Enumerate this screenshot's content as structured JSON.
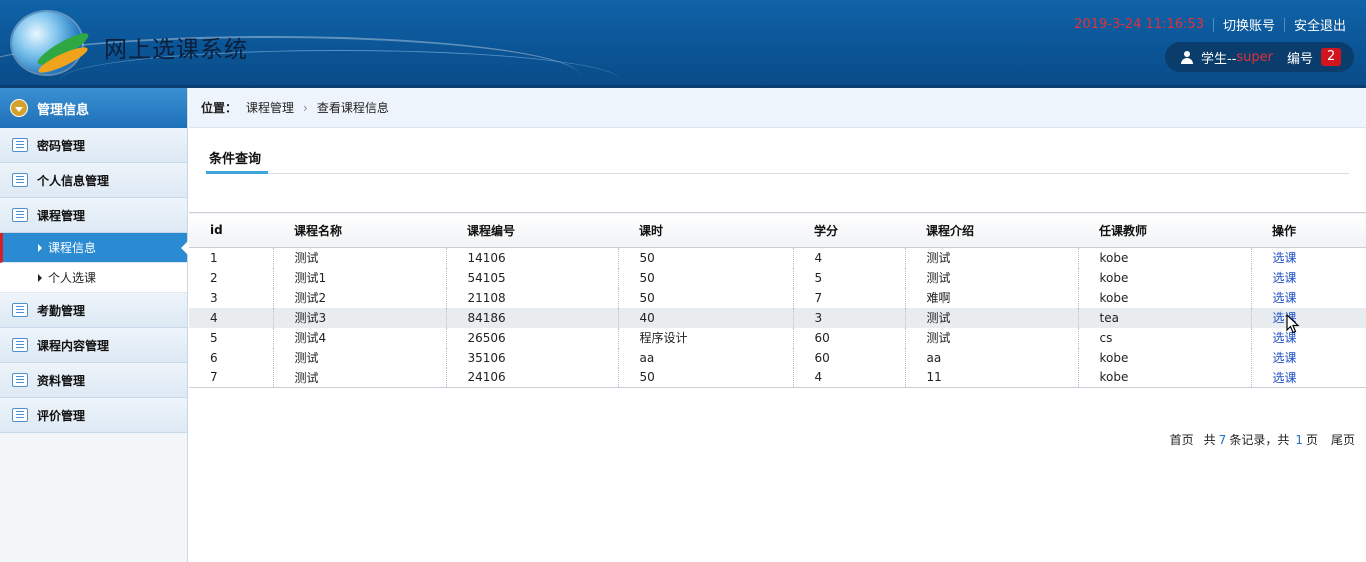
{
  "header": {
    "app_title": "网上选课系统",
    "datetime": "2019-3-24 11:16:53",
    "switch_account": "切换账号",
    "logout": "安全退出",
    "user_role": "学生--",
    "user_name": "super",
    "id_label": "编号",
    "id_value": "2"
  },
  "sidebar": {
    "header": "管理信息",
    "groups": [
      {
        "label": "密码管理"
      },
      {
        "label": "个人信息管理"
      },
      {
        "label": "课程管理",
        "children": [
          {
            "label": "课程信息",
            "active": true
          },
          {
            "label": "个人选课",
            "active": false
          }
        ]
      },
      {
        "label": "考勤管理"
      },
      {
        "label": "课程内容管理"
      },
      {
        "label": "资料管理"
      },
      {
        "label": "评价管理"
      }
    ]
  },
  "breadcrumb": {
    "label": "位置：",
    "items": [
      "课程管理",
      "查看课程信息"
    ]
  },
  "query_tab": "条件查询",
  "table": {
    "headers": [
      "id",
      "课程名称",
      "课程编号",
      "课时",
      "学分",
      "课程介绍",
      "任课教师",
      "操作"
    ],
    "action_label": "选课",
    "rows": [
      [
        "1",
        "测试",
        "14106",
        "50",
        "4",
        "测试",
        "kobe"
      ],
      [
        "2",
        "测试1",
        "54105",
        "50",
        "5",
        "测试",
        "kobe"
      ],
      [
        "3",
        "测试2",
        "21108",
        "50",
        "7",
        "难啊",
        "kobe"
      ],
      [
        "4",
        "测试3",
        "84186",
        "40",
        "3",
        "测试",
        "tea"
      ],
      [
        "5",
        "测试4",
        "26506",
        "程序设计",
        "60",
        "测试",
        "cs"
      ],
      [
        "6",
        "测试",
        "35106",
        "aa",
        "60",
        "aa",
        "kobe"
      ],
      [
        "7",
        "测试",
        "24106",
        "50",
        "4",
        "11",
        "kobe"
      ]
    ],
    "hover_row": 3
  },
  "pager": {
    "first": "首页",
    "total_prefix": "共",
    "total_records": "7",
    "records_suffix": "条记录，共",
    "total_pages": "1",
    "pages_suffix": "页",
    "last": "尾页"
  }
}
